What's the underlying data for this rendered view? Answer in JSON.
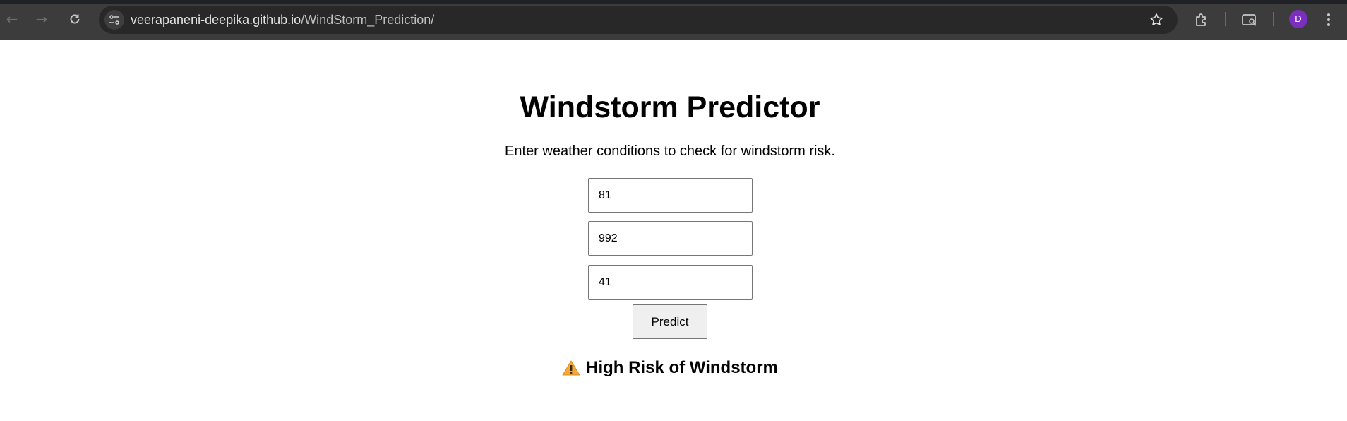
{
  "browser": {
    "url_host": "veerapaneni-deepika.github.io",
    "url_path": "/WindStorm_Prediction/",
    "profile_initial": "D",
    "accent_avatar": "#7b2fbe"
  },
  "page": {
    "title": "Windstorm Predictor",
    "subtitle": "Enter weather conditions to check for windstorm risk.",
    "inputs": [
      {
        "value": "81"
      },
      {
        "value": "992"
      },
      {
        "value": "41"
      }
    ],
    "predict_label": "Predict",
    "result": {
      "icon": "warning-icon",
      "text": "High Risk of Windstorm"
    }
  }
}
